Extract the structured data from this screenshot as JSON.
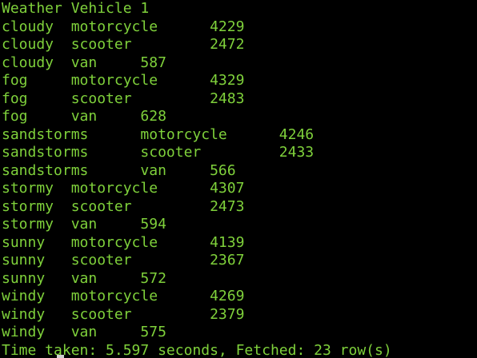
{
  "terminal": {
    "foreground": "#7fd13b",
    "background": "#000000",
    "lines": [
      "Weather Vehicle 1",
      "cloudy  motorcycle      4229",
      "cloudy  scooter         2472",
      "cloudy  van     587",
      "fog     motorcycle      4329",
      "fog     scooter         2483",
      "fog     van     628",
      "sandstorms      motorcycle      4246",
      "sandstorms      scooter         2433",
      "sandstorms      van     566",
      "stormy  motorcycle      4307",
      "stormy  scooter         2473",
      "stormy  van     594",
      "sunny   motorcycle      4139",
      "sunny   scooter         2367",
      "sunny   van     572",
      "windy   motorcycle      4269",
      "windy   scooter         2379",
      "windy   van     575",
      "Time taken: 5.597 seconds, Fetched: 23 row(s)"
    ]
  }
}
